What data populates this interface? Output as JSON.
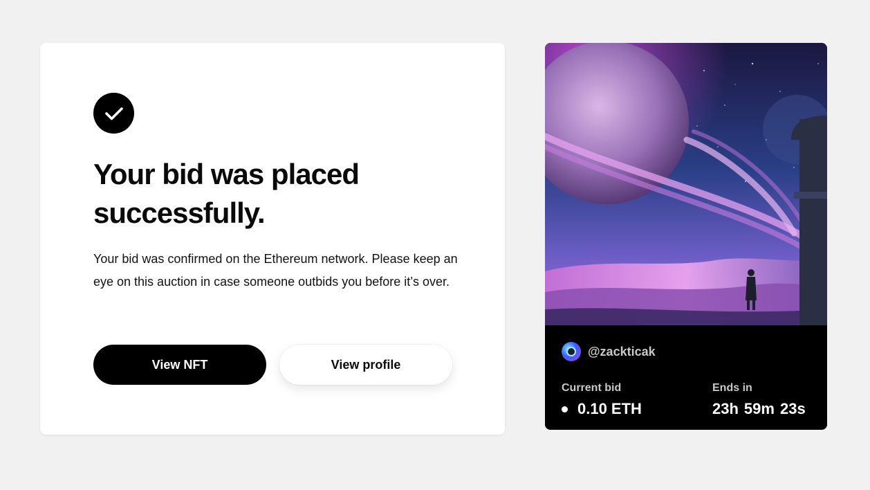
{
  "confirmation": {
    "icon": "check-icon",
    "headline": "Your bid was placed successfully.",
    "body": "Your bid was confirmed on the Ethereum network. Please keep an eye on this auction in case someone outbids you before it’s over.",
    "primary_button": "View NFT",
    "secondary_button": "View profile"
  },
  "nft": {
    "artwork": "planet-landscape-artwork",
    "creator": "@zackticak",
    "current_bid_label": "Current bid",
    "current_bid_value": "0.10 ETH",
    "ends_in_label": "Ends in",
    "timer": {
      "hours": "23h",
      "minutes": "59m",
      "seconds": "23s"
    }
  },
  "colors": {
    "background": "#f1f1f1",
    "primary_button": "#000000",
    "nft_info_background": "#000000"
  }
}
